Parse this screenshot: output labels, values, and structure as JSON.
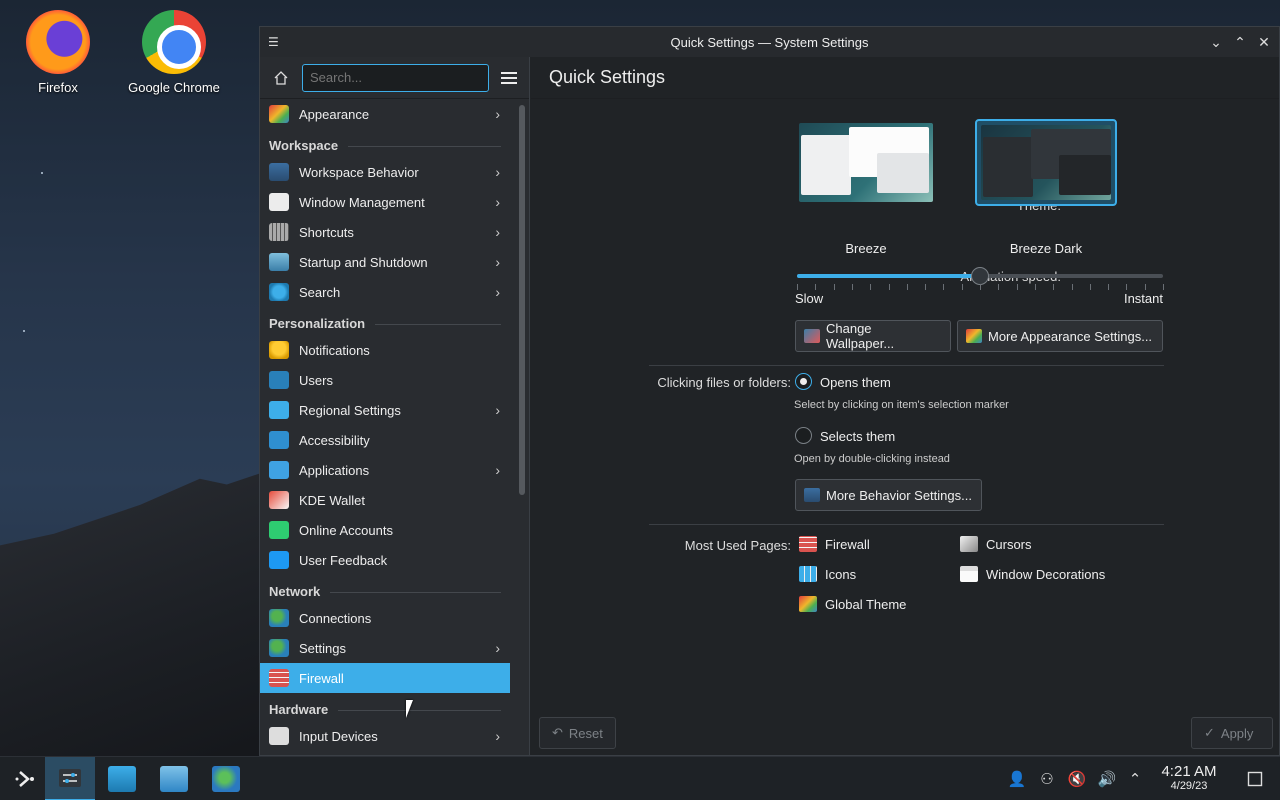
{
  "desktop": {
    "icons": [
      {
        "label": "Firefox",
        "icon": "firefox-icon"
      },
      {
        "label": "Google Chrome",
        "icon": "chrome-icon"
      }
    ]
  },
  "window": {
    "title": "Quick Settings — System Settings",
    "controls": {
      "minimize": "⌄",
      "maximize": "⌃",
      "close": "✕"
    }
  },
  "sidebar": {
    "search_placeholder": "Search...",
    "entries": [
      {
        "type": "item",
        "label": "Appearance",
        "icon": "appearance-icon",
        "arrow": true
      },
      {
        "type": "section",
        "label": "Workspace"
      },
      {
        "type": "item",
        "label": "Workspace Behavior",
        "icon": "workspace-behavior-icon",
        "arrow": true
      },
      {
        "type": "item",
        "label": "Window Management",
        "icon": "window-management-icon",
        "arrow": true
      },
      {
        "type": "item",
        "label": "Shortcuts",
        "icon": "keyboard-icon",
        "arrow": true
      },
      {
        "type": "item",
        "label": "Startup and Shutdown",
        "icon": "startup-icon",
        "arrow": true
      },
      {
        "type": "item",
        "label": "Search",
        "icon": "search-icon",
        "arrow": true
      },
      {
        "type": "section",
        "label": "Personalization"
      },
      {
        "type": "item",
        "label": "Notifications",
        "icon": "bell-icon",
        "arrow": false
      },
      {
        "type": "item",
        "label": "Users",
        "icon": "users-icon",
        "arrow": false
      },
      {
        "type": "item",
        "label": "Regional Settings",
        "icon": "regional-icon",
        "arrow": true
      },
      {
        "type": "item",
        "label": "Accessibility",
        "icon": "accessibility-icon",
        "arrow": false
      },
      {
        "type": "item",
        "label": "Applications",
        "icon": "applications-icon",
        "arrow": true
      },
      {
        "type": "item",
        "label": "KDE Wallet",
        "icon": "wallet-icon",
        "arrow": false
      },
      {
        "type": "item",
        "label": "Online Accounts",
        "icon": "online-accounts-icon",
        "arrow": false
      },
      {
        "type": "item",
        "label": "User Feedback",
        "icon": "feedback-icon",
        "arrow": false
      },
      {
        "type": "section",
        "label": "Network"
      },
      {
        "type": "item",
        "label": "Connections",
        "icon": "globe-icon",
        "arrow": false
      },
      {
        "type": "item",
        "label": "Settings",
        "icon": "globe-icon",
        "arrow": true
      },
      {
        "type": "item",
        "label": "Firewall",
        "icon": "firewall-icon",
        "arrow": false,
        "active": true
      },
      {
        "type": "section",
        "label": "Hardware"
      },
      {
        "type": "item",
        "label": "Input Devices",
        "icon": "input-devices-icon",
        "arrow": true
      }
    ]
  },
  "main": {
    "header": "Quick Settings",
    "theme": {
      "label": "Theme:",
      "options": [
        {
          "name": "Breeze",
          "selected": false
        },
        {
          "name": "Breeze Dark",
          "selected": true
        }
      ]
    },
    "animation": {
      "label": "Animation speed:",
      "min_label": "Slow",
      "max_label": "Instant",
      "value_fraction": 0.5
    },
    "appearance_buttons": {
      "wallpaper": "Change Wallpaper...",
      "more_appearance": "More Appearance Settings..."
    },
    "clicking": {
      "label": "Clicking files or folders:",
      "opens": "Opens them",
      "opens_hint": "Select by clicking on item's selection marker",
      "selects": "Selects them",
      "selects_hint": "Open by double-clicking instead",
      "more_behavior": "More Behavior Settings..."
    },
    "most_used": {
      "label": "Most Used Pages:",
      "pages": [
        "Firewall",
        "Cursors",
        "Icons",
        "Window Decorations",
        "Global Theme"
      ]
    },
    "footer": {
      "reset": "Reset",
      "apply": "Apply"
    }
  },
  "taskbar": {
    "clock_time": "4:21 AM",
    "clock_date": "4/29/23"
  },
  "colors": {
    "accent": "#3daee9",
    "window_bg": "#202326",
    "sidebar_bg": "#292c30"
  }
}
